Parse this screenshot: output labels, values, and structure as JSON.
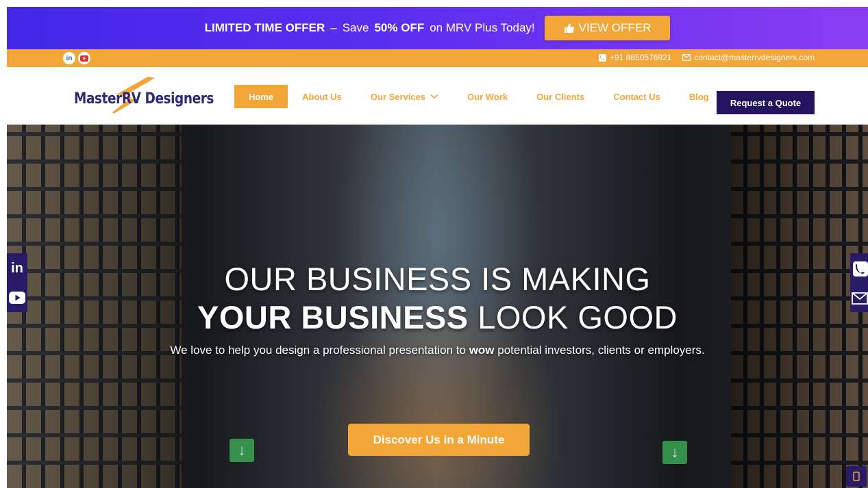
{
  "promo": {
    "lead": "LIMITED TIME OFFER",
    "dash": "–",
    "save": "Save",
    "percent": "50% OFF",
    "rest": "on MRV Plus Today!",
    "button_label": "VIEW OFFER",
    "button_icon": "thumbs-up-icon"
  },
  "contact_bar": {
    "social": [
      "linkedin-icon",
      "youtube-icon"
    ],
    "phone": "+91 8850576921",
    "email": "contact@masterrvdesigners.com"
  },
  "nav": {
    "logo_text": "MasterRV Designers",
    "items": [
      {
        "label": "Home",
        "active": true
      },
      {
        "label": "About Us"
      },
      {
        "label": "Our Services",
        "has_dropdown": true
      },
      {
        "label": "Our Work"
      },
      {
        "label": "Our Clients"
      },
      {
        "label": "Contact Us"
      },
      {
        "label": "Blog"
      }
    ],
    "quote_button": "Request a Quote"
  },
  "hero": {
    "line1": "OUR BUSINESS IS MAKING",
    "line2_bold": "YOUR BUSINESS",
    "line2_rest": "LOOK GOOD",
    "sub_pre": "We love to help you design a professional presentation to",
    "sub_bold": "wow",
    "sub_post": "potential investors, clients or employers.",
    "cta": "Discover Us in a Minute"
  },
  "colors": {
    "accent": "#f2a637",
    "brand_dark": "#24135f",
    "promo_gradient": [
      "#4327e6",
      "#8a3df0"
    ]
  }
}
